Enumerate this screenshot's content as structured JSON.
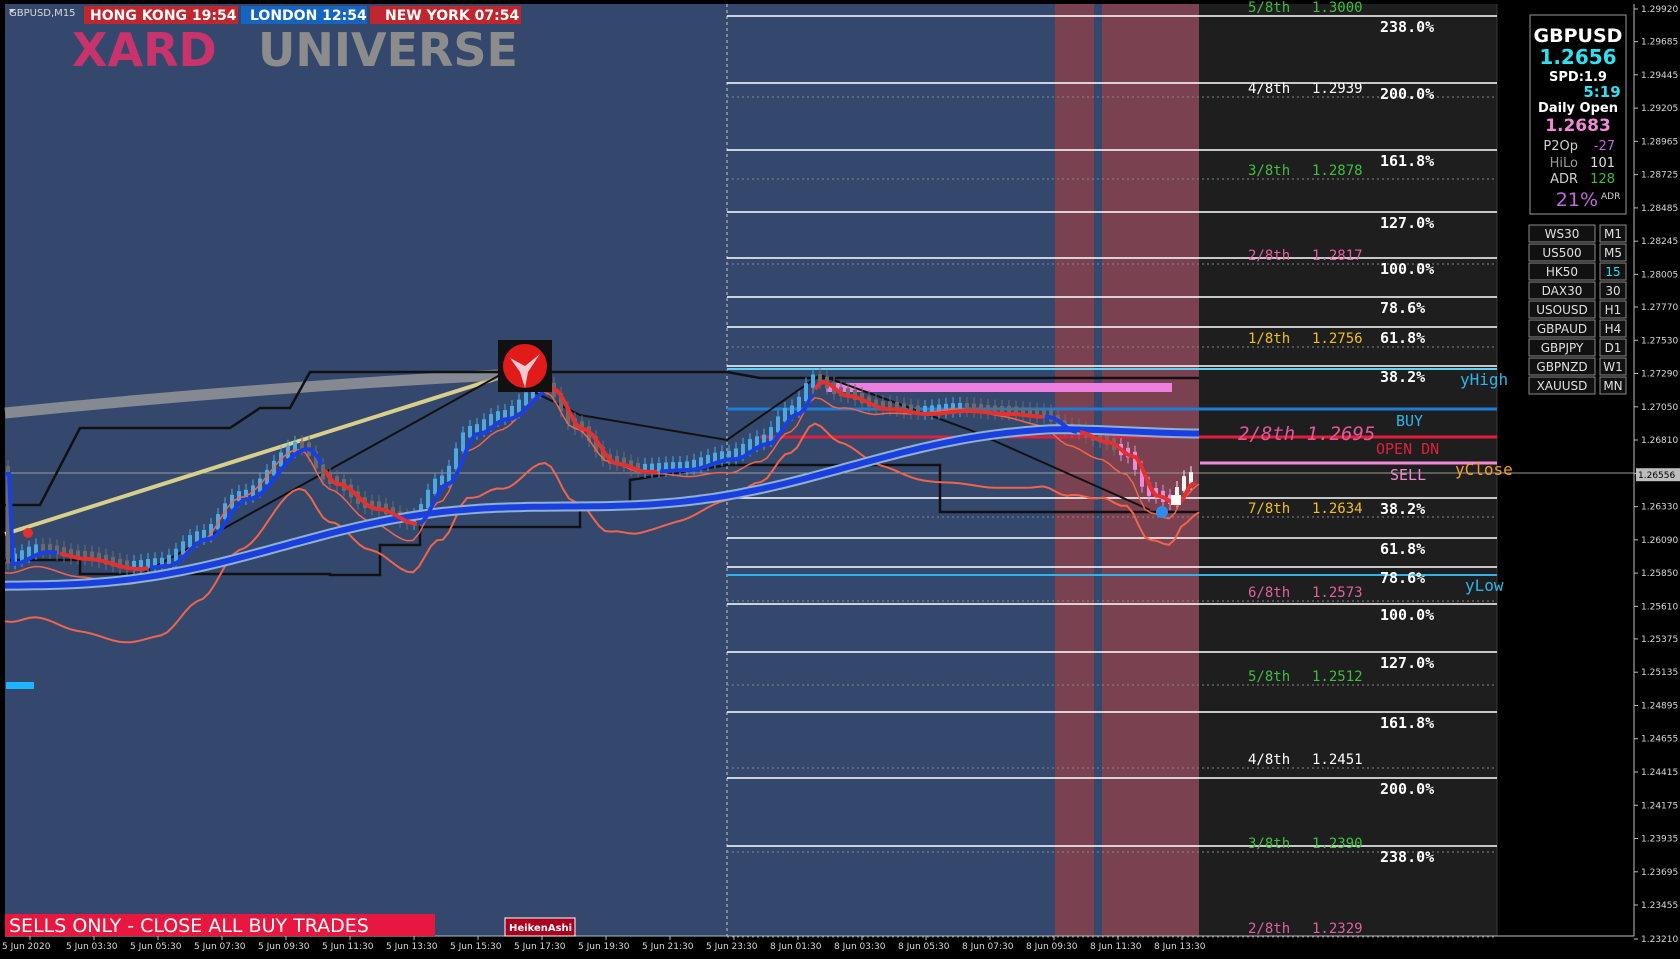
{
  "chart_title": "GBPUSD,M15",
  "sessions": [
    {
      "label": "HONG KONG 19:54",
      "color": "#c0262d"
    },
    {
      "label": "LONDON 12:54",
      "color": "#1565c0"
    },
    {
      "label": "NEW YORK 07:54",
      "color": "#c0262d"
    }
  ],
  "brand": {
    "part1": "XARD",
    "part2": "UNIVERSE"
  },
  "dashboard": {
    "symbol": "GBPUSD",
    "price": "1.2656",
    "spread": "SPD:1.9",
    "timer": "5:19",
    "daily_open_label": "Daily Open",
    "daily_open_value": "1.2683",
    "stats": [
      {
        "label": "P2Op",
        "value": "-27",
        "color": "#c06bd8"
      },
      {
        "label": "HiLo",
        "value": "101",
        "color": "#e0e0e0"
      },
      {
        "label": "ADR",
        "value": "128",
        "color": "#3fbf3f"
      }
    ],
    "adr_pct": "21%",
    "adr_pct_suffix": "ADR"
  },
  "symbol_buttons": [
    "WS30",
    "US500",
    "HK50",
    "DAX30",
    "USOUSD",
    "GBPAUD",
    "GBPJPY",
    "GBPNZD",
    "XAUUSD"
  ],
  "timeframe_buttons": [
    "M1",
    "M5",
    "15",
    "30",
    "H1",
    "H4",
    "D1",
    "W1",
    "MN"
  ],
  "active_timeframe": "15",
  "price_axis": [
    "1.29920",
    "1.29685",
    "1.29445",
    "1.29205",
    "1.28965",
    "1.28725",
    "1.28485",
    "1.28245",
    "1.28005",
    "1.27770",
    "1.27530",
    "1.27290",
    "1.27050",
    "1.26810",
    "1.26570",
    "1.26330",
    "1.26090",
    "1.25850",
    "1.25610",
    "1.25375",
    "1.25135",
    "1.24895",
    "1.24655",
    "1.24415",
    "1.24175",
    "1.23935",
    "1.23695",
    "1.23455",
    "1.23210"
  ],
  "current_price": "1.26556",
  "time_axis": [
    "5 Jun 2020",
    "5 Jun 03:30",
    "5 Jun 05:30",
    "5 Jun 07:30",
    "5 Jun 09:30",
    "5 Jun 11:30",
    "5 Jun 13:30",
    "5 Jun 15:30",
    "5 Jun 17:30",
    "5 Jun 19:30",
    "5 Jun 21:30",
    "5 Jun 23:30",
    "8 Jun 01:30",
    "8 Jun 03:30",
    "8 Jun 05:30",
    "8 Jun 07:30",
    "8 Jun 09:30",
    "8 Jun 11:30",
    "8 Jun 13:30"
  ],
  "murrey_levels": [
    {
      "label": "5/8th",
      "value": "1.3000",
      "color": "#3fbf3f"
    },
    {
      "label": "4/8th",
      "value": "1.2939",
      "color": "#ffffff"
    },
    {
      "label": "3/8th",
      "value": "1.2878",
      "color": "#3fbf3f"
    },
    {
      "label": "2/8th",
      "value": "1.2817",
      "color": "#e060a0"
    },
    {
      "label": "1/8th",
      "value": "1.2756",
      "color": "#f0c020"
    },
    {
      "label": "7/8th",
      "value": "1.2634",
      "color": "#f0c020"
    },
    {
      "label": "6/8th",
      "value": "1.2573",
      "color": "#e060a0"
    },
    {
      "label": "5/8th",
      "value": "1.2512",
      "color": "#3fbf3f"
    },
    {
      "label": "4/8th",
      "value": "1.2451",
      "color": "#ffffff"
    },
    {
      "label": "3/8th",
      "value": "1.2390",
      "color": "#3fbf3f"
    },
    {
      "label": "2/8th",
      "value": "1.2329",
      "color": "#e060a0"
    }
  ],
  "fib_levels": [
    "238.0%",
    "200.0%",
    "161.8%",
    "127.0%",
    "100.0%",
    "78.6%",
    "61.8%",
    "38.2%",
    "38.2%",
    "61.8%",
    "78.6%",
    "100.0%",
    "127.0%",
    "161.8%",
    "200.0%",
    "238.0%"
  ],
  "trade_labels": {
    "yhigh": "yHigh",
    "buy": "BUY",
    "mid_level": "2/8th 1.2695",
    "open_dn": "OPEN DN",
    "sell": "SELL",
    "yclose": "yClose",
    "ylow": "yLow"
  },
  "alert_banner": "SELLS ONLY - CLOSE ALL BUY TRADES",
  "heiken_badge": "HeikenAshi",
  "colors": {
    "chart_bg": "#34486e",
    "right_bg": "#1e1e1e",
    "kill_zone": "#7a4150",
    "fast_ma": "#e53030",
    "slow_ma": "#1a3fe0",
    "envelope": "#f0654a"
  }
}
